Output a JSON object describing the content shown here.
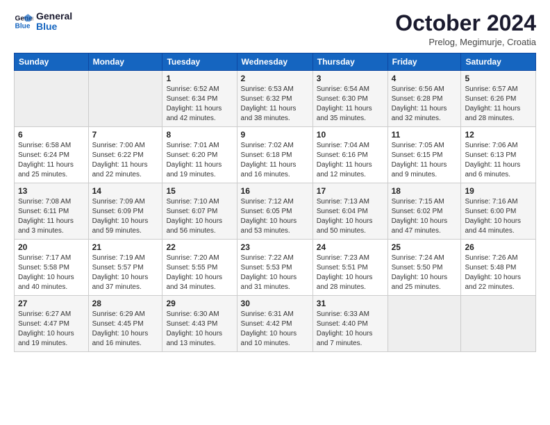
{
  "logo": {
    "line1": "General",
    "line2": "Blue"
  },
  "title": "October 2024",
  "location": "Prelog, Megimurje, Croatia",
  "weekdays": [
    "Sunday",
    "Monday",
    "Tuesday",
    "Wednesday",
    "Thursday",
    "Friday",
    "Saturday"
  ],
  "weeks": [
    [
      {
        "day": null,
        "info": null
      },
      {
        "day": null,
        "info": null
      },
      {
        "day": "1",
        "info": "Sunrise: 6:52 AM\nSunset: 6:34 PM\nDaylight: 11 hours and 42 minutes."
      },
      {
        "day": "2",
        "info": "Sunrise: 6:53 AM\nSunset: 6:32 PM\nDaylight: 11 hours and 38 minutes."
      },
      {
        "day": "3",
        "info": "Sunrise: 6:54 AM\nSunset: 6:30 PM\nDaylight: 11 hours and 35 minutes."
      },
      {
        "day": "4",
        "info": "Sunrise: 6:56 AM\nSunset: 6:28 PM\nDaylight: 11 hours and 32 minutes."
      },
      {
        "day": "5",
        "info": "Sunrise: 6:57 AM\nSunset: 6:26 PM\nDaylight: 11 hours and 28 minutes."
      }
    ],
    [
      {
        "day": "6",
        "info": "Sunrise: 6:58 AM\nSunset: 6:24 PM\nDaylight: 11 hours and 25 minutes."
      },
      {
        "day": "7",
        "info": "Sunrise: 7:00 AM\nSunset: 6:22 PM\nDaylight: 11 hours and 22 minutes."
      },
      {
        "day": "8",
        "info": "Sunrise: 7:01 AM\nSunset: 6:20 PM\nDaylight: 11 hours and 19 minutes."
      },
      {
        "day": "9",
        "info": "Sunrise: 7:02 AM\nSunset: 6:18 PM\nDaylight: 11 hours and 16 minutes."
      },
      {
        "day": "10",
        "info": "Sunrise: 7:04 AM\nSunset: 6:16 PM\nDaylight: 11 hours and 12 minutes."
      },
      {
        "day": "11",
        "info": "Sunrise: 7:05 AM\nSunset: 6:15 PM\nDaylight: 11 hours and 9 minutes."
      },
      {
        "day": "12",
        "info": "Sunrise: 7:06 AM\nSunset: 6:13 PM\nDaylight: 11 hours and 6 minutes."
      }
    ],
    [
      {
        "day": "13",
        "info": "Sunrise: 7:08 AM\nSunset: 6:11 PM\nDaylight: 11 hours and 3 minutes."
      },
      {
        "day": "14",
        "info": "Sunrise: 7:09 AM\nSunset: 6:09 PM\nDaylight: 10 hours and 59 minutes."
      },
      {
        "day": "15",
        "info": "Sunrise: 7:10 AM\nSunset: 6:07 PM\nDaylight: 10 hours and 56 minutes."
      },
      {
        "day": "16",
        "info": "Sunrise: 7:12 AM\nSunset: 6:05 PM\nDaylight: 10 hours and 53 minutes."
      },
      {
        "day": "17",
        "info": "Sunrise: 7:13 AM\nSunset: 6:04 PM\nDaylight: 10 hours and 50 minutes."
      },
      {
        "day": "18",
        "info": "Sunrise: 7:15 AM\nSunset: 6:02 PM\nDaylight: 10 hours and 47 minutes."
      },
      {
        "day": "19",
        "info": "Sunrise: 7:16 AM\nSunset: 6:00 PM\nDaylight: 10 hours and 44 minutes."
      }
    ],
    [
      {
        "day": "20",
        "info": "Sunrise: 7:17 AM\nSunset: 5:58 PM\nDaylight: 10 hours and 40 minutes."
      },
      {
        "day": "21",
        "info": "Sunrise: 7:19 AM\nSunset: 5:57 PM\nDaylight: 10 hours and 37 minutes."
      },
      {
        "day": "22",
        "info": "Sunrise: 7:20 AM\nSunset: 5:55 PM\nDaylight: 10 hours and 34 minutes."
      },
      {
        "day": "23",
        "info": "Sunrise: 7:22 AM\nSunset: 5:53 PM\nDaylight: 10 hours and 31 minutes."
      },
      {
        "day": "24",
        "info": "Sunrise: 7:23 AM\nSunset: 5:51 PM\nDaylight: 10 hours and 28 minutes."
      },
      {
        "day": "25",
        "info": "Sunrise: 7:24 AM\nSunset: 5:50 PM\nDaylight: 10 hours and 25 minutes."
      },
      {
        "day": "26",
        "info": "Sunrise: 7:26 AM\nSunset: 5:48 PM\nDaylight: 10 hours and 22 minutes."
      }
    ],
    [
      {
        "day": "27",
        "info": "Sunrise: 6:27 AM\nSunset: 4:47 PM\nDaylight: 10 hours and 19 minutes."
      },
      {
        "day": "28",
        "info": "Sunrise: 6:29 AM\nSunset: 4:45 PM\nDaylight: 10 hours and 16 minutes."
      },
      {
        "day": "29",
        "info": "Sunrise: 6:30 AM\nSunset: 4:43 PM\nDaylight: 10 hours and 13 minutes."
      },
      {
        "day": "30",
        "info": "Sunrise: 6:31 AM\nSunset: 4:42 PM\nDaylight: 10 hours and 10 minutes."
      },
      {
        "day": "31",
        "info": "Sunrise: 6:33 AM\nSunset: 4:40 PM\nDaylight: 10 hours and 7 minutes."
      },
      {
        "day": null,
        "info": null
      },
      {
        "day": null,
        "info": null
      }
    ]
  ]
}
